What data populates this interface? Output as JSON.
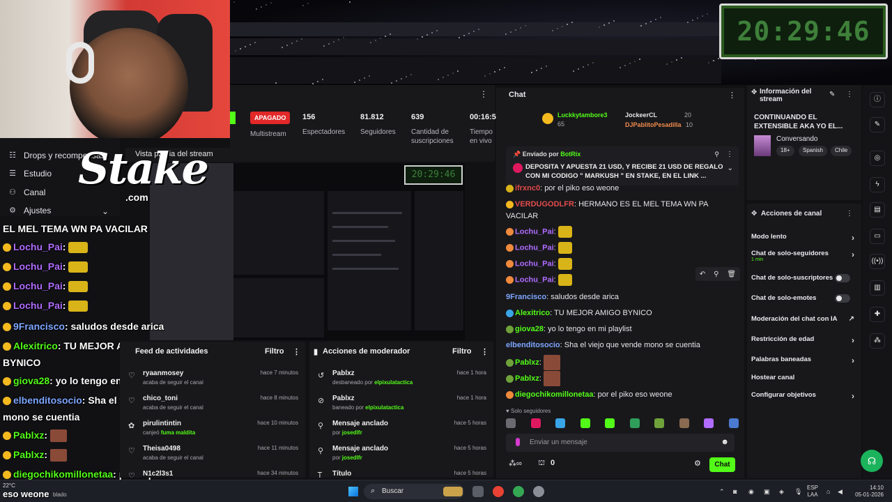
{
  "clock": "20:29:46",
  "preview_clock": "20:29:46",
  "stake": {
    "brand": "Stake",
    "domain": ".com"
  },
  "left_nav": {
    "items": [
      {
        "label": "Drops y recompensas",
        "icon": "gift-icon"
      },
      {
        "label": "Estudio",
        "icon": "studio-icon"
      },
      {
        "label": "Canal",
        "icon": "channel-icon"
      },
      {
        "label": "Ajustes",
        "icon": "gear-icon"
      }
    ]
  },
  "stats": {
    "status": "APAGADO",
    "multistream": "Multistream",
    "items": [
      {
        "value": "156",
        "label": "Espectadores"
      },
      {
        "value": "81.812",
        "label": "Seguidores"
      },
      {
        "value": "639",
        "label": "Cantidad de suscripciones"
      },
      {
        "value": "00:16:5",
        "label": "Tiempo en vivo"
      }
    ]
  },
  "preview": {
    "title": "Vista previa del stream"
  },
  "overlay_chat": [
    {
      "user": "",
      "text": "EL MEL TEMA WN PA VACILAR",
      "color": "#ffffff"
    },
    {
      "user": "Lochu_Pai",
      "text": ":",
      "color": "#b06cff",
      "emote": true
    },
    {
      "user": "Lochu_Pai",
      "text": ":",
      "color": "#b06cff",
      "emote": true
    },
    {
      "user": "Lochu_Pai",
      "text": ":",
      "color": "#b06cff",
      "emote": true
    },
    {
      "user": "Lochu_Pai",
      "text": ":",
      "color": "#b06cff",
      "emote": true
    },
    {
      "user": "9Francisco",
      "text": ": saludos desde arica",
      "color": "#7ea6ff"
    },
    {
      "user": "Alexitrico",
      "text": ": TU MEJOR AMIGO",
      "color": "#53fc18"
    },
    {
      "user": "",
      "text": "BYNICO",
      "color": "#ffffff"
    },
    {
      "user": "giova28",
      "text": ": yo lo tengo en mi playlist",
      "color": "#53fc18"
    },
    {
      "user": "elbenditosocio",
      "text": ": Sha el viejo que vende",
      "color": "#7ea6ff"
    },
    {
      "user": "",
      "text": "mono se cuentia",
      "color": "#ffffff"
    },
    {
      "user": "Pablxz",
      "text": ":",
      "color": "#53fc18",
      "emote2": true
    },
    {
      "user": "Pablxz",
      "text": ":",
      "color": "#53fc18",
      "emote2": true
    },
    {
      "user": "diegochikomillonetaa",
      "text": ": por el piko",
      "color": "#53fc18"
    },
    {
      "user": "",
      "text": "eso weone",
      "color": "#ffffff"
    }
  ],
  "feed": {
    "title": "Feed de actividades",
    "filter": "Filtro",
    "rows": [
      {
        "name": "ryaanmosey",
        "sub": "acaba de seguir el canal",
        "time": "hace 7 minutos"
      },
      {
        "name": "chico_toni",
        "sub": "acaba de seguir el canal",
        "time": "hace 8 minutos"
      },
      {
        "name": "pirulintintin",
        "sub": "canjeó",
        "sub_b": "fuma maldita",
        "time": "hace 10 minutos"
      },
      {
        "name": "Theisa0498",
        "sub": "acaba de seguir el canal",
        "time": "hace 11 minutos"
      },
      {
        "name": "N1c2l3s1",
        "sub": "",
        "time": "hace 34 minutos"
      }
    ]
  },
  "mod_actions": {
    "title": "Acciones de moderador",
    "filter": "Filtro",
    "rows": [
      {
        "name": "Pablxz",
        "sub": "desbaneado por",
        "sub_b": "elpixulatactica",
        "time": "hace 1 hora"
      },
      {
        "name": "Pablxz",
        "sub": "baneado por",
        "sub_b": "elpixulatactica",
        "time": "hace 1 hora"
      },
      {
        "name": "Mensaje anclado",
        "sub": "por",
        "sub_b": "josedlfr",
        "time": "hace 5 horas"
      },
      {
        "name": "Mensaje anclado",
        "sub": "por",
        "sub_b": "josedlfr",
        "time": "hace 5 horas"
      },
      {
        "name": "Título",
        "sub": "",
        "time": "hace 5 horas"
      }
    ]
  },
  "chat": {
    "title": "Chat",
    "gifters": [
      {
        "name": "Luckkytambore3",
        "count": "65"
      },
      {
        "name": "JockeerCL",
        "count": "20"
      },
      {
        "name": "DJPablitoPesadilla",
        "count": "10"
      }
    ],
    "pinned": {
      "by_label": "Enviado por",
      "by_user": "BotRix",
      "text": "DEPOSITA Y APUESTA 21 USD, Y RECIBE 21 USD DE REGALO CON MI CODIGO \" MARKUSH \" EN STAKE, EN EL LINK ..."
    },
    "messages": [
      {
        "user": "ifrxnc0",
        "text": ": por el piko eso weone",
        "color": "#e34c4c"
      },
      {
        "user": "VERDUGODLFR",
        "text": ": HERMANO ES EL MEL TEMA WN PA VACILAR",
        "color": "#e34c4c"
      },
      {
        "user": "Lochu_Pai",
        "text": ":",
        "color": "#b06cff"
      },
      {
        "user": "Lochu_Pai",
        "text": ":",
        "color": "#b06cff"
      },
      {
        "user": "Lochu_Pai",
        "text": ":",
        "color": "#b06cff"
      },
      {
        "user": "Lochu_Pai",
        "text": ":",
        "color": "#b06cff"
      },
      {
        "user": "9Francisco",
        "text": ": saludos desde arica",
        "color": "#7ea6ff"
      },
      {
        "user": "Alexitrico",
        "text": ": TU MEJOR AMIGO BYNICO",
        "color": "#53fc18"
      },
      {
        "user": "giova28",
        "text": ": yo lo tengo en mi playlist",
        "color": "#53fc18"
      },
      {
        "user": "elbenditosocio",
        "text": ": Sha el viejo que vende mono se cuentia",
        "color": "#7ea6ff"
      },
      {
        "user": "Pablxz",
        "text": ":",
        "color": "#53fc18"
      },
      {
        "user": "Pablxz",
        "text": ":",
        "color": "#53fc18"
      },
      {
        "user": "diegochikomillonetaa",
        "text": ": por el piko eso weone",
        "color": "#53fc18"
      }
    ],
    "solo_label": "Solo seguidores",
    "input_placeholder": "Enviar un mensaje",
    "points": "0",
    "send_label": "Chat"
  },
  "stream_info": {
    "header": "Información del stream",
    "title": "CONTINUANDO EL EXTENSIBLE AKA YO EL...",
    "category": "Conversando",
    "tags": [
      "18+",
      "Spanish",
      "Chile"
    ]
  },
  "channel_actions": {
    "header": "Acciones de canal",
    "items": [
      {
        "label": "Modo lento",
        "kind": "chevron"
      },
      {
        "label": "Chat de solo-seguidores",
        "sub": "1 min",
        "kind": "chevron"
      },
      {
        "label": "Chat de solo-suscriptores",
        "kind": "toggle"
      },
      {
        "label": "Chat de solo-emotes",
        "kind": "toggle"
      },
      {
        "label": "Moderación del chat con IA",
        "kind": "external"
      },
      {
        "label": "Restricción de edad",
        "kind": "chevron"
      },
      {
        "label": "Palabras baneadas",
        "kind": "chevron"
      },
      {
        "label": "Hostear canal",
        "kind": "none"
      },
      {
        "label": "Configurar objetivos",
        "kind": "chevron"
      }
    ]
  },
  "taskbar": {
    "temp": "22°C",
    "weather_label": "eso weone",
    "weather_sub": "blado",
    "search": "Buscar",
    "lang": "ESP",
    "lang2": "LAA",
    "time": "14:10",
    "date": "05-01-2026"
  },
  "colors": {
    "accent": "#53fc18",
    "danger": "#e22828",
    "panel": "#18181b"
  }
}
